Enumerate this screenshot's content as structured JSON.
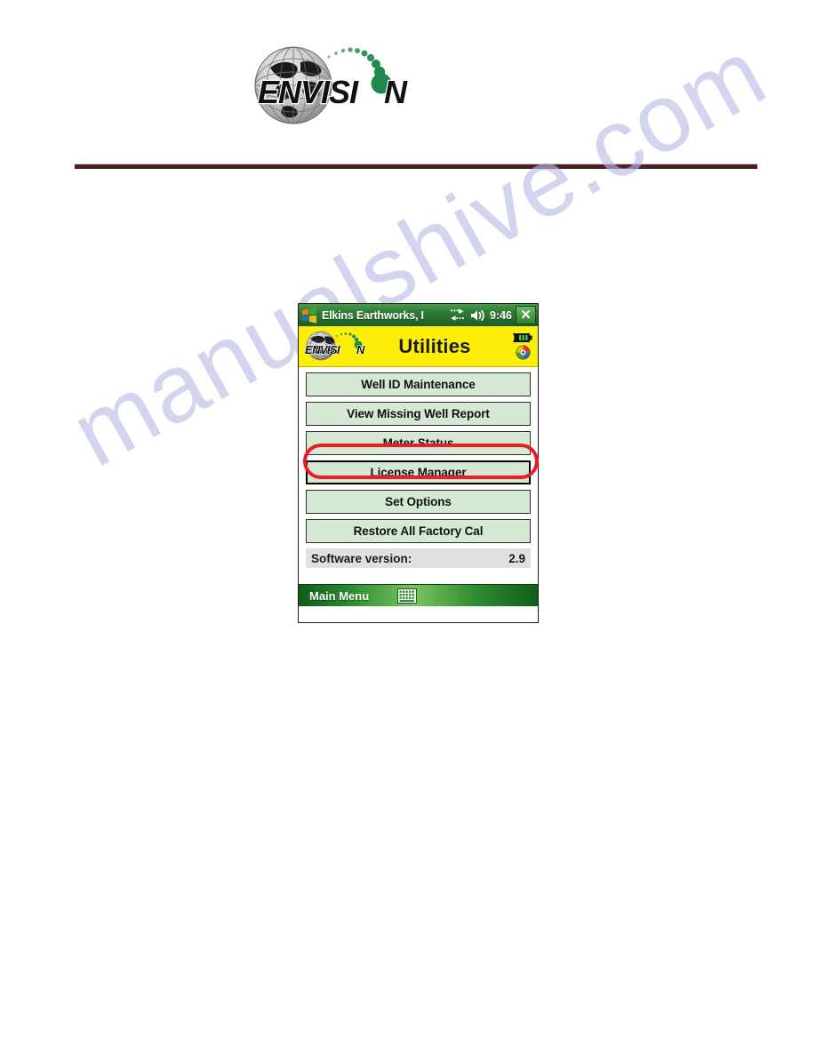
{
  "page": {
    "watermark": "manualshive.com",
    "logo_text": "ENVISION"
  },
  "device": {
    "titlebar": {
      "start_icon": "windows-start-flag-icon",
      "app_name": "Elkins Earthworks, I",
      "connectivity_icon": "connectivity-arrows-icon",
      "volume_icon": "speaker-volume-icon",
      "clock": "9:46",
      "close_label": "✕"
    },
    "header": {
      "logo_text": "ENVISION",
      "title": "Utilities",
      "battery_icon": "battery-icon",
      "help_icon": "color-wheel-icon"
    },
    "menu": {
      "buttons": [
        {
          "label": "Well ID Maintenance",
          "focused": false,
          "highlighted": false
        },
        {
          "label": "View Missing Well Report",
          "focused": false,
          "highlighted": false
        },
        {
          "label": "Meter Status",
          "focused": false,
          "highlighted": true
        },
        {
          "label": "License Manager",
          "focused": true,
          "highlighted": false
        },
        {
          "label": "Set Options",
          "focused": false,
          "highlighted": false
        },
        {
          "label": "Restore All Factory Cal",
          "focused": false,
          "highlighted": false
        }
      ],
      "version_label": "Software version:",
      "version_value": "2.9"
    },
    "softbar": {
      "left_softkey": "Main Menu",
      "sip_icon": "keyboard-sip-icon"
    }
  },
  "annotation": {
    "shape": "red-oval",
    "color": "#ed1c24",
    "targets": "Meter Status"
  }
}
